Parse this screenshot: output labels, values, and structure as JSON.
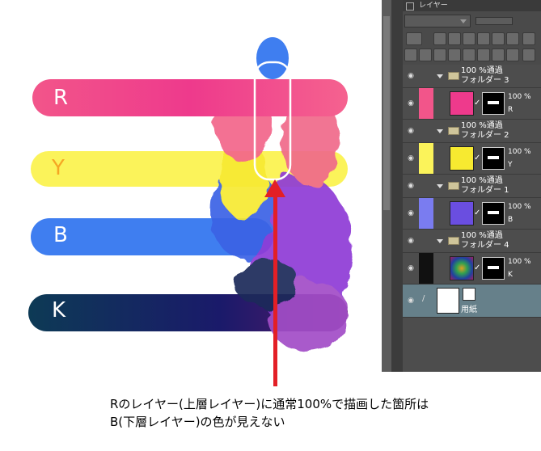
{
  "canvas": {
    "bars": [
      {
        "id": "R",
        "label": "R",
        "color": "#f2558a",
        "label_color": "#ffffff"
      },
      {
        "id": "Y",
        "label": "Y",
        "color": "#fbf35a",
        "label_color": "#f5a623"
      },
      {
        "id": "B",
        "label": "B",
        "color": "#3f7ef0",
        "label_color": "#ffffff"
      },
      {
        "id": "K",
        "label": "K",
        "color": "#1a2a6a",
        "label_color": "#ffffff"
      }
    ]
  },
  "panel": {
    "tab_label": "レイヤー",
    "layers": [
      {
        "type": "folder",
        "opacity": "100 %通過",
        "name": "フォルダー 3",
        "color": "#f2558a"
      },
      {
        "type": "layer",
        "opacity": "100 %",
        "name": "R",
        "color": "#f2558a"
      },
      {
        "type": "folder",
        "opacity": "100 %通過",
        "name": "フォルダー 2",
        "color": "#fbf35a"
      },
      {
        "type": "layer",
        "opacity": "100 %",
        "name": "Y",
        "color": "#fbf35a"
      },
      {
        "type": "folder",
        "opacity": "100 %通過",
        "name": "フォルダー 1",
        "color": "#7a7cf0"
      },
      {
        "type": "layer",
        "opacity": "100 %",
        "name": "B",
        "color": "#7a7cf0"
      },
      {
        "type": "folder",
        "opacity": "100 %通過",
        "name": "フォルダー 4",
        "color": "#111111"
      },
      {
        "type": "layer",
        "opacity": "100 %",
        "name": "K",
        "color": "#111111"
      },
      {
        "type": "paper",
        "name": "用紙"
      }
    ]
  },
  "caption": {
    "line1": "Rのレイヤー(上層レイヤー)に通常100%で描画した箇所は",
    "line2": "B(下層レイヤー)の色が見えない"
  },
  "colors": {
    "accent_red": "#e31f26",
    "highlight_outline": "#ffffff"
  }
}
